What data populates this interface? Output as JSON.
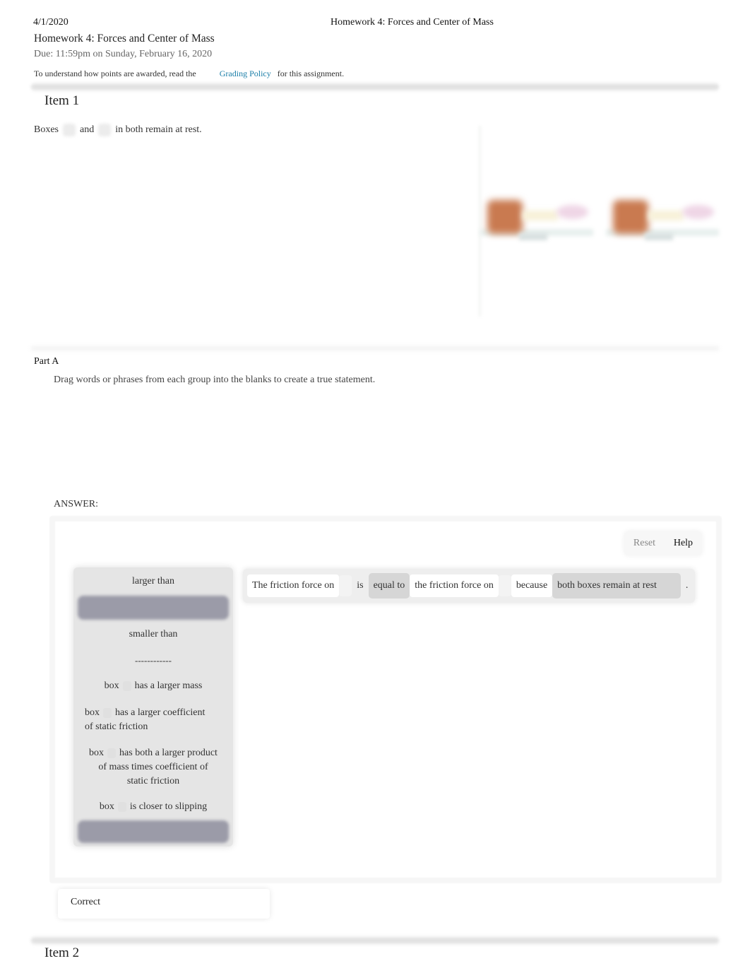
{
  "print_header": {
    "date": "4/1/2020",
    "title": "Homework 4: Forces and Center of Mass"
  },
  "assignment": {
    "title": "Homework 4: Forces and Center of Mass",
    "due": "Due: 11:59pm on Sunday, February 16, 2020",
    "policy_prefix": "To understand how points are awarded, read the",
    "policy_link": "Grading Policy",
    "policy_suffix": "for this assignment."
  },
  "item1": {
    "heading": "Item 1",
    "intro_a": "Boxes",
    "intro_b": "and",
    "intro_c": "in both remain at rest.",
    "figure": {
      "description": "Two blurred diagrams, each showing an orange box on a surface with a spring/scale",
      "box_color": "#c97a50"
    },
    "part_a": {
      "label": "Part A",
      "instructions": "Drag words or phrases from each group into the blanks to create a true statement.",
      "answer_label": "ANSWER:",
      "toolbar": {
        "reset": "Reset",
        "help": "Help"
      },
      "options": [
        {
          "type": "text",
          "label": "larger than"
        },
        {
          "type": "empty"
        },
        {
          "type": "text",
          "label": "smaller than"
        },
        {
          "type": "text",
          "label": "------------"
        },
        {
          "type": "box",
          "prefix": "box",
          "label": "has a larger mass"
        },
        {
          "type": "box",
          "prefix": "box",
          "label": "has a larger coefficient of static friction"
        },
        {
          "type": "box",
          "prefix": "box",
          "label": "has both a larger product of mass times coefficient of static friction"
        },
        {
          "type": "box",
          "prefix": "box",
          "label": "is closer to slipping"
        },
        {
          "type": "empty"
        }
      ],
      "statement": {
        "s1": "The friction force on",
        "s2": "is",
        "blank1": "equal to",
        "s3": "the friction force on",
        "s4": "because",
        "blank2": "both boxes remain at rest",
        "end": "."
      },
      "feedback": "Correct"
    }
  },
  "item2": {
    "heading": "Item 2"
  }
}
